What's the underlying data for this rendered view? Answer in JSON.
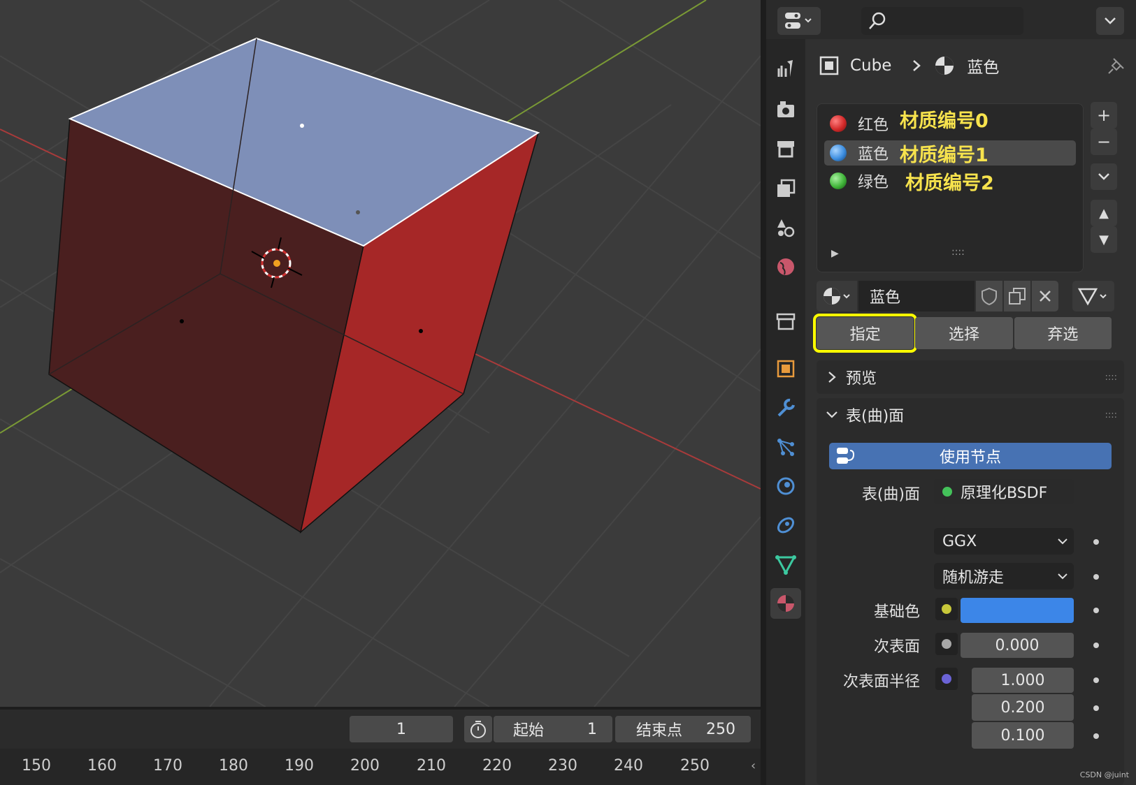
{
  "viewport": {
    "colors": {
      "background": "#3b3b3b",
      "top_face": "#7e8fb8",
      "front_face": "#4a1f1f",
      "right_face": "#a62727",
      "x_axis": "#a83b3b",
      "y_axis": "#7a9a35"
    }
  },
  "timeline": {
    "current_frame": "1",
    "start_label": "起始",
    "start_value": "1",
    "end_label": "结束点",
    "end_value": "250",
    "ruler": [
      "150",
      "160",
      "170",
      "180",
      "190",
      "200",
      "210",
      "220",
      "230",
      "240",
      "250"
    ]
  },
  "properties": {
    "breadcrumb": {
      "object": "Cube",
      "material": "蓝色"
    },
    "slots": [
      {
        "name": "红色",
        "note": "材质编号0",
        "color": "#d32a2a"
      },
      {
        "name": "蓝色",
        "note": "材质编号1",
        "color": "#3d8ee0"
      },
      {
        "name": "绿色",
        "note": "材质编号2",
        "color": "#41b53a"
      }
    ],
    "list_grip": "::::",
    "material_name": "蓝色",
    "buttons": {
      "assign": "指定",
      "select": "选择",
      "deselect": "弃选"
    },
    "sections": {
      "preview": "预览",
      "surface": "表(曲)面"
    },
    "use_nodes": "使用节点",
    "surface_label": "表(曲)面",
    "surface_value": "原理化BSDF",
    "distribution": "GGX",
    "subsurface_method": "随机游走",
    "base_color_label": "基础色",
    "base_color": "#3c86e8",
    "subsurface_label": "次表面",
    "subsurface_value": "0.000",
    "subsurface_radius_label": "次表面半径",
    "subsurface_radius": [
      "1.000",
      "0.200",
      "0.100"
    ]
  },
  "watermark": "CSDN @juint"
}
